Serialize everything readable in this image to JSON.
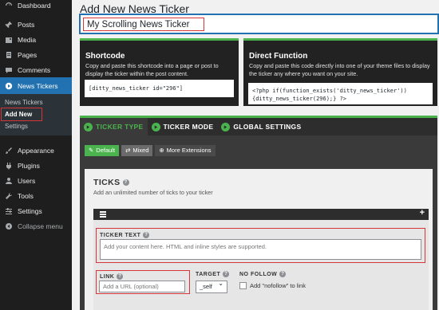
{
  "sidebar": {
    "items_top": [
      {
        "label": "Dashboard",
        "icon": "dashboard-icon"
      },
      {
        "label": "Posts",
        "icon": "pin-icon"
      },
      {
        "label": "Media",
        "icon": "media-icon"
      },
      {
        "label": "Pages",
        "icon": "pages-icon"
      },
      {
        "label": "Comments",
        "icon": "comment-icon"
      },
      {
        "label": "News Tickers",
        "icon": "ticker-icon"
      }
    ],
    "submenu": [
      "News Tickers",
      "Add New",
      "Settings"
    ],
    "items_bottom": [
      {
        "label": "Appearance",
        "icon": "brush-icon"
      },
      {
        "label": "Plugins",
        "icon": "plugin-icon"
      },
      {
        "label": "Users",
        "icon": "users-icon"
      },
      {
        "label": "Tools",
        "icon": "wrench-icon"
      },
      {
        "label": "Settings",
        "icon": "settings-icon"
      },
      {
        "label": "Collapse menu",
        "icon": "collapse-icon"
      }
    ]
  },
  "page": {
    "title": "Add New News Ticker",
    "ticker_title": "My Scrolling News Ticker"
  },
  "shortcode": {
    "heading": "Shortcode",
    "desc": "Copy and paste this shortcode into a page or post to display the ticker within the post content.",
    "code": "[ditty_news_ticker id=\"296\"]"
  },
  "direct": {
    "heading": "Direct Function",
    "desc": "Copy and paste this code directly into one of your theme files to display the ticker any where you want on your site.",
    "code": "<?php if(function_exists('ditty_news_ticker')){ditty_news_ticker(296);} ?>"
  },
  "tabs": [
    "TICKER TYPE",
    "TICKER MODE",
    "GLOBAL SETTINGS"
  ],
  "subtabs": [
    "Default",
    "Mixed",
    "More Extensions"
  ],
  "ticks": {
    "title": "TICKS",
    "desc": "Add an unlimited number of ticks to your ticker",
    "ticker_text_label": "TICKER TEXT",
    "ticker_text_placeholder": "Add your content here. HTML and inline styles are supported.",
    "link_label": "LINK",
    "link_placeholder": "Add a URL (optional)",
    "target_label": "TARGET",
    "target_value": "_self",
    "nofollow_label": "NO FOLLOW",
    "nofollow_text": "Add \"nofollow\" to link"
  },
  "colors": {
    "accent": "#4ab34d",
    "highlight": "#d63638",
    "wp_blue": "#2271b1"
  }
}
